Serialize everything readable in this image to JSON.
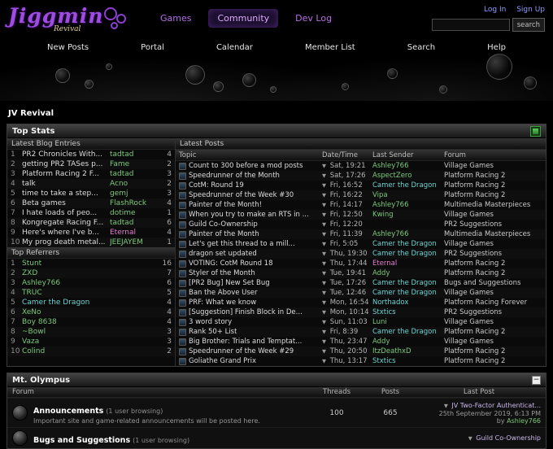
{
  "header": {
    "logo": "Jiggmin",
    "logo_sub": "Revival",
    "nav": [
      {
        "label": "Games",
        "active": false
      },
      {
        "label": "Community",
        "active": true
      },
      {
        "label": "Dev Log",
        "active": false
      }
    ],
    "login": "Log In",
    "signup": "Sign Up",
    "search_button": "search",
    "search_value": ""
  },
  "subnav": [
    "New Posts",
    "Portal",
    "Calendar",
    "Member List",
    "Search",
    "Help"
  ],
  "breadcrumb": "JV Revival",
  "colors": {
    "accent_purple": "#b76ee8",
    "user_green": "#7cc97c",
    "user_teal": "#6fd3d3",
    "user_pink": "#e57fd3"
  },
  "top_stats": {
    "title": "Top Stats",
    "blog_title": "Latest Blog Entries",
    "blog_entries": [
      {
        "rank": "1",
        "title": "PR2 Chronicles With...",
        "author": "tadtad",
        "author_color": "green",
        "count": "4"
      },
      {
        "rank": "2",
        "title": "getting PR2 TASes p...",
        "author": "Fame",
        "author_color": "green",
        "count": "2"
      },
      {
        "rank": "3",
        "title": "Platform Racing 2 F...",
        "author": "tadtad",
        "author_color": "green",
        "count": "3"
      },
      {
        "rank": "4",
        "title": "talk",
        "author": "Acno",
        "author_color": "green",
        "count": "2"
      },
      {
        "rank": "5",
        "title": "time to take a step...",
        "author": "gemj",
        "author_color": "green",
        "count": "3"
      },
      {
        "rank": "6",
        "title": "Beta games",
        "author": "FlashRock",
        "author_color": "green",
        "count": "4"
      },
      {
        "rank": "7",
        "title": "I hate loads of peo...",
        "author": "dotime",
        "author_color": "green",
        "count": "1"
      },
      {
        "rank": "8",
        "title": "Kongregate Racing F...",
        "author": "tadtad",
        "author_color": "green",
        "count": "6"
      },
      {
        "rank": "9",
        "title": "Here's where I've b...",
        "author": "Eternal",
        "author_color": "pink",
        "count": "4"
      },
      {
        "rank": "10",
        "title": "My prog death metal...",
        "author": "JEEJAYEM",
        "author_color": "green",
        "count": "1"
      }
    ],
    "referrers_title": "Top Referrers",
    "referrers": [
      {
        "rank": "1",
        "name": "Stunt",
        "color": "green",
        "count": "16"
      },
      {
        "rank": "2",
        "name": "ZXD",
        "color": "green",
        "count": "7"
      },
      {
        "rank": "3",
        "name": "Ashley766",
        "color": "green",
        "count": "6"
      },
      {
        "rank": "4",
        "name": "TRUC",
        "color": "green",
        "count": "5"
      },
      {
        "rank": "5",
        "name": "Camer the Dragon",
        "color": "teal",
        "count": "4"
      },
      {
        "rank": "6",
        "name": "XeNo",
        "color": "green",
        "count": "4"
      },
      {
        "rank": "7",
        "name": "Boy 8638",
        "color": "green",
        "count": "4"
      },
      {
        "rank": "8",
        "name": "~Bowl",
        "color": "green",
        "count": "3"
      },
      {
        "rank": "9",
        "name": "Vaza",
        "color": "green",
        "count": "3"
      },
      {
        "rank": "10",
        "name": "Colind",
        "color": "green",
        "count": "2"
      }
    ],
    "posts_title": "Latest Posts",
    "posts_columns": [
      "Topic",
      "Date/Time",
      "Last Sender",
      "Forum"
    ],
    "posts": [
      {
        "topic": "Count to 300 before a mod posts",
        "time": "Sat, 19:21",
        "sender": "Ashley766",
        "sender_color": "green",
        "forum": "Village Games"
      },
      {
        "topic": "Speedrunner of the Month",
        "time": "Sat, 17:26",
        "sender": "AspectZero",
        "sender_color": "green",
        "forum": "Platform Racing 2"
      },
      {
        "topic": "CotM: Round 19",
        "time": "Fri, 16:52",
        "sender": "Camer the Dragon",
        "sender_color": "teal",
        "forum": "Platform Racing 2"
      },
      {
        "topic": "Speedrunner of the Week #30",
        "time": "Fri, 16:22",
        "sender": "Vipa",
        "sender_color": "green",
        "forum": "Platform Racing 2"
      },
      {
        "topic": "Painter of the Month!",
        "time": "Fri, 14:17",
        "sender": "Ashley766",
        "sender_color": "green",
        "forum": "Multimedia Masterpieces"
      },
      {
        "topic": "When you try to make an RTS in ...",
        "time": "Fri, 12:50",
        "sender": "Kwing",
        "sender_color": "green",
        "forum": "Village Games"
      },
      {
        "topic": "Guild Co-Ownership",
        "time": "Fri, 12:20",
        "sender": "",
        "sender_color": "green",
        "forum": "PR2 Suggestions"
      },
      {
        "topic": "Painter of the Month",
        "time": "Fri, 11:39",
        "sender": "Ashley766",
        "sender_color": "green",
        "forum": "Multimedia Masterpieces"
      },
      {
        "topic": "Let's get this thread to a mill...",
        "time": "Fri, 5:05",
        "sender": "Camer the Dragon",
        "sender_color": "teal",
        "forum": "Village Games"
      },
      {
        "topic": "dragon set updated",
        "time": "Thu, 19:30",
        "sender": "Camer the Dragon",
        "sender_color": "teal",
        "forum": "PR2 Suggestions"
      },
      {
        "topic": "VOTING: CotM Round 18",
        "time": "Thu, 17:44",
        "sender": "Eternal",
        "sender_color": "pink",
        "forum": "Platform Racing 2"
      },
      {
        "topic": "Styler of the Month",
        "time": "Tue, 19:41",
        "sender": "Addy",
        "sender_color": "green",
        "forum": "Platform Racing 2"
      },
      {
        "topic": "[PR2 Bug]  New Set Bug",
        "time": "Tue, 17:26",
        "sender": "Camer the Dragon",
        "sender_color": "teal",
        "forum": "Bugs and Suggestions"
      },
      {
        "topic": "Ban the Above User",
        "time": "Tue, 12:46",
        "sender": "Camer the Dragon",
        "sender_color": "teal",
        "forum": "Village Games"
      },
      {
        "topic": "PRF: What we know",
        "time": "Mon, 16:54",
        "sender": "Northadox",
        "sender_color": "teal",
        "forum": "Platform Racing Forever"
      },
      {
        "topic": "[Suggestion] Finish Block in De...",
        "time": "Mon, 10:14",
        "sender": "Stxtics",
        "sender_color": "teal",
        "forum": "PR2 Suggestions"
      },
      {
        "topic": "3 word story",
        "time": "Sun, 11:03",
        "sender": "Luni",
        "sender_color": "green",
        "forum": "Village Games"
      },
      {
        "topic": "Rank 50+ List",
        "time": "Fri, 8:39",
        "sender": "Camer the Dragon",
        "sender_color": "teal",
        "forum": "Platform Racing 2"
      },
      {
        "topic": "Big Brother: Trials and Temptat...",
        "time": "Thu, 23:47",
        "sender": "Addy",
        "sender_color": "green",
        "forum": "Village Games"
      },
      {
        "topic": "Speedrunner of the Week #29",
        "time": "Thu, 20:50",
        "sender": "ItzDeathxD",
        "sender_color": "green",
        "forum": "Platform Racing 2"
      },
      {
        "topic": "Goliathe Grand Prix",
        "time": "Thu, 13:17",
        "sender": "Stxtics",
        "sender_color": "teal",
        "forum": "Platform Racing 2"
      }
    ]
  },
  "category": {
    "title": "Mt. Olympus",
    "columns": [
      "Forum",
      "Threads",
      "Posts",
      "Last Post"
    ],
    "collapse_label": "−",
    "forums": [
      {
        "name": "Announcements",
        "browsing": "(1 user browsing)",
        "description": "Important site and game-related announcements will be posted here.",
        "threads": "100",
        "posts": "665",
        "last_title": "JV Two-Factor Authenticat...",
        "last_date": "25th September 2019, 6:13 PM",
        "last_by": "by",
        "last_user": "Ashley766",
        "last_user_color": "green"
      },
      {
        "name": "Bugs and Suggestions",
        "browsing": "(1 user browsing)",
        "description": "",
        "threads": "",
        "posts": "",
        "last_title": "Guild Co-Ownership",
        "last_date": "",
        "last_by": "",
        "last_user": "",
        "last_user_color": "green"
      }
    ]
  }
}
